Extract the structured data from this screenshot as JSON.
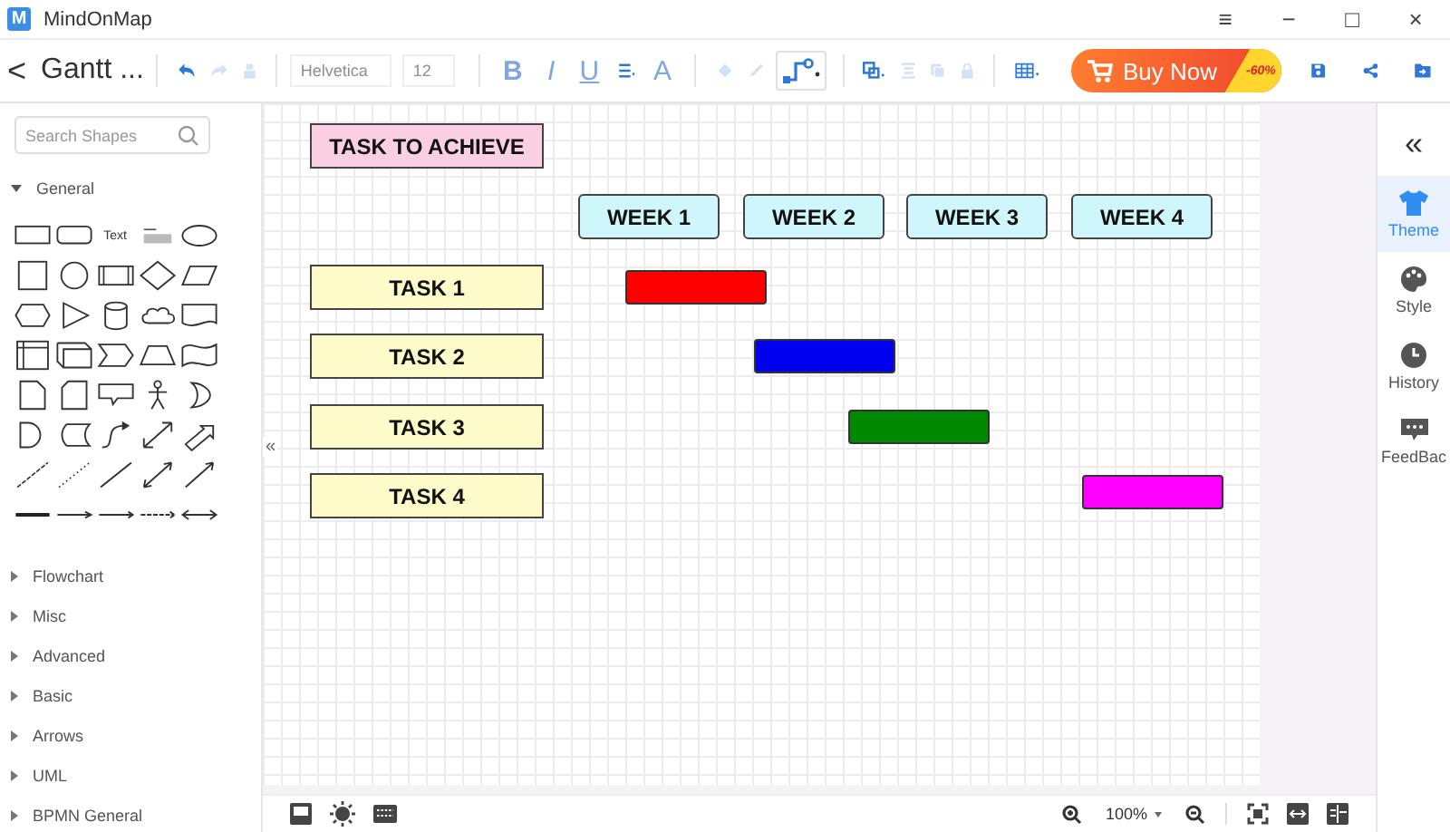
{
  "window": {
    "logo_letter": "M",
    "title": "MindOnMap",
    "controls": [
      "≡",
      "−",
      "□",
      "×"
    ]
  },
  "toolbar": {
    "back": "<",
    "document_title": "Gantt ...",
    "undo": {
      "disabled": false
    },
    "redo": {
      "disabled": true
    },
    "font": {
      "value": "Helvetica",
      "disabled": true
    },
    "size": {
      "value": "12",
      "disabled": true
    },
    "format_buttons": [
      {
        "label": "B",
        "disabled": true
      },
      {
        "label": "I",
        "disabled": true
      },
      {
        "label": "U",
        "disabled": true
      }
    ],
    "font_color": {
      "label": "A",
      "disabled": true
    },
    "buy_now": {
      "label": "Buy Now",
      "badge": "-60%"
    }
  },
  "sidebar": {
    "search": {
      "placeholder": "Search Shapes"
    },
    "palette_text_label": "Text",
    "groups": [
      {
        "label": "General",
        "expanded": true
      },
      {
        "label": "Flowchart",
        "expanded": false
      },
      {
        "label": "Misc",
        "expanded": false
      },
      {
        "label": "Advanced",
        "expanded": false
      },
      {
        "label": "Basic",
        "expanded": false
      },
      {
        "label": "Arrows",
        "expanded": false
      },
      {
        "label": "UML",
        "expanded": false
      },
      {
        "label": "BPMN General",
        "expanded": false
      }
    ],
    "collapse": "«"
  },
  "canvas": {
    "nodes": [
      {
        "kind": "title",
        "text": "TASK TO ACHIEVE"
      },
      {
        "kind": "week",
        "text": "WEEK 1"
      },
      {
        "kind": "week",
        "text": "WEEK 2"
      },
      {
        "kind": "week",
        "text": "WEEK 3"
      },
      {
        "kind": "week",
        "text": "WEEK 4"
      },
      {
        "kind": "task",
        "text": "TASK 1"
      },
      {
        "kind": "task",
        "text": "TASK 2"
      },
      {
        "kind": "task",
        "text": "TASK 3"
      },
      {
        "kind": "task",
        "text": "TASK 4"
      },
      {
        "kind": "bar",
        "color": "#ff0000"
      },
      {
        "kind": "bar",
        "color": "#0000ee"
      },
      {
        "kind": "bar",
        "color": "#008800"
      },
      {
        "kind": "bar",
        "color": "#ff00ff"
      }
    ]
  },
  "right_panel": {
    "collapse": "«",
    "items": [
      {
        "label": "Theme",
        "selected": true
      },
      {
        "label": "Style",
        "selected": false
      },
      {
        "label": "History",
        "selected": false
      },
      {
        "label": "FeedBac",
        "selected": false
      }
    ]
  },
  "bottom_bar": {
    "zoom": "100%"
  }
}
